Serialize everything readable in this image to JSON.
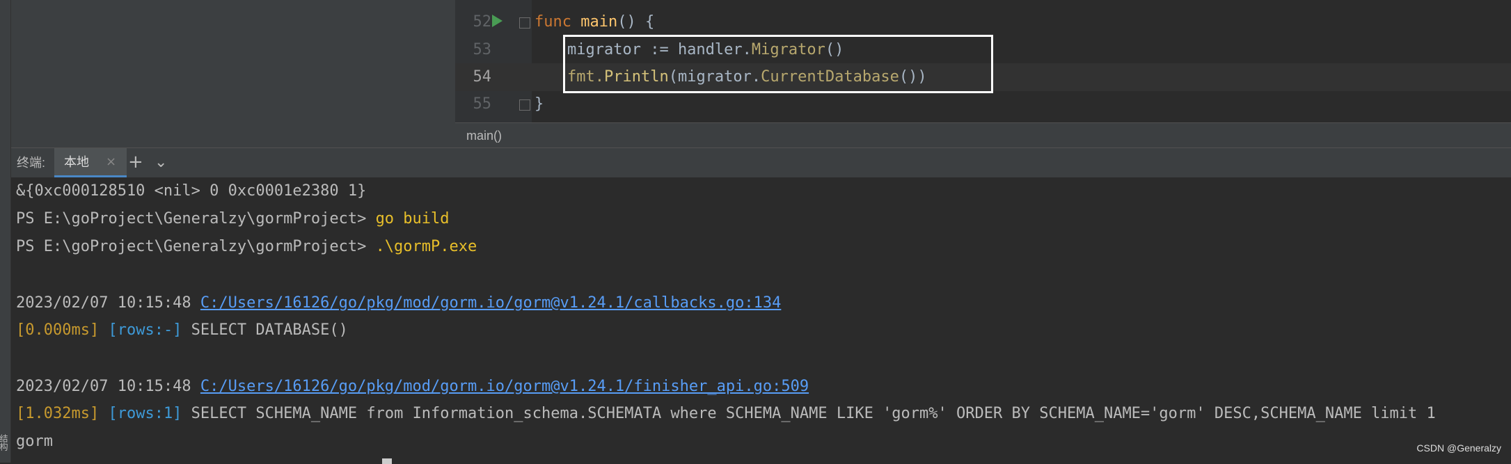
{
  "editor": {
    "lines": [
      {
        "num": "52",
        "t1": "func",
        "t2": " ",
        "t3": "main",
        "t4": "() {"
      },
      {
        "num": "53",
        "t1": "migrator := handler.",
        "t2": "Migrator",
        "t3": "()"
      },
      {
        "num": "54",
        "t1": "fmt.",
        "t2": "Println",
        "t3": "(migrator.",
        "t4": "CurrentDatabase",
        "t5": "())"
      },
      {
        "num": "55",
        "t1": "}"
      }
    ]
  },
  "breadcrumb": {
    "label": "main()"
  },
  "terminal_panel": {
    "prefix": "终端:",
    "tab_local": "本地",
    "tab_close": "×",
    "add": "+",
    "chevron": "⌄"
  },
  "terminal": {
    "l1": "&{0xc000128510 <nil> 0 0xc0001e2380 1}",
    "l2_prompt": "PS E:\\goProject\\Generalzy\\gormProject> ",
    "l2_cmd": "go build",
    "l3_prompt": "PS E:\\goProject\\Generalzy\\gormProject> ",
    "l3_cmd": ".\\gormP.exe",
    "l4_time": "2023/02/07 10:15:48 ",
    "l4_link": "C:/Users/16126/go/pkg/mod/gorm.io/gorm@v1.24.1/callbacks.go:134",
    "l5_ms": "[0.000ms]",
    "l5_rows": "[rows:-]",
    "l5_sql": " SELECT DATABASE()",
    "l6_time": "2023/02/07 10:15:48 ",
    "l6_link": "C:/Users/16126/go/pkg/mod/gorm.io/gorm@v1.24.1/finisher_api.go:509",
    "l7_ms": "[1.032ms]",
    "l7_rows": "[rows:1]",
    "l7_sql": " SELECT SCHEMA_NAME from Information_schema.SCHEMATA where SCHEMA_NAME LIKE 'gorm%' ORDER BY SCHEMA_NAME='gorm' DESC,SCHEMA_NAME limit 1",
    "l8": "gorm"
  },
  "side": {
    "vertical_label": "结构"
  },
  "watermark": "CSDN @Generalzy"
}
